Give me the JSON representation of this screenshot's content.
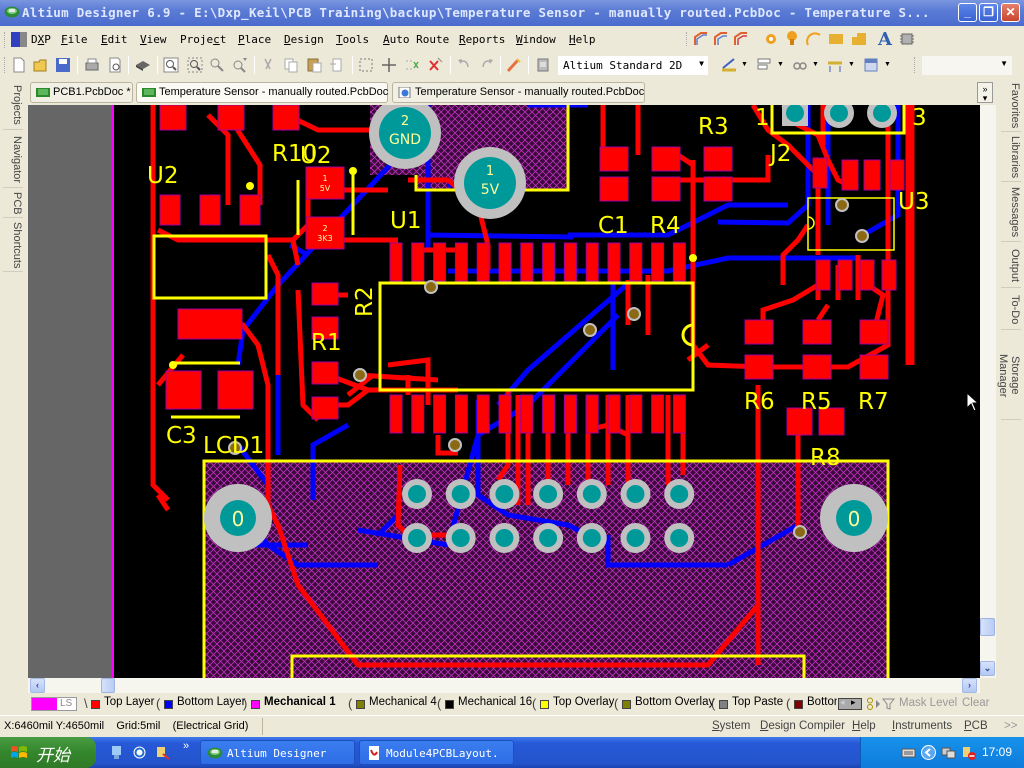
{
  "window": {
    "title": "Altium Designer 6.9 - E:\\Dxp_Keil\\PCB Training\\backup\\Temperature Sensor - manually routed.PcbDoc - Temperature S...",
    "minimize": "_",
    "restore": "❐",
    "close": "✕"
  },
  "menu": {
    "items": [
      {
        "label": "DXP",
        "underline": "X"
      },
      {
        "label": "File",
        "underline": "F"
      },
      {
        "label": "Edit",
        "underline": "E"
      },
      {
        "label": "View",
        "underline": "V"
      },
      {
        "label": "Project",
        "underline": "c"
      },
      {
        "label": "Place",
        "underline": "P"
      },
      {
        "label": "Design",
        "underline": "D"
      },
      {
        "label": "Tools",
        "underline": "T"
      },
      {
        "label": "Auto Route",
        "underline": "A"
      },
      {
        "label": "Reports",
        "underline": "R"
      },
      {
        "label": "Window",
        "underline": "W"
      },
      {
        "label": "Help",
        "underline": "H"
      }
    ]
  },
  "toolbar": {
    "view_mode": "Altium Standard 2D",
    "right_combo_value": "",
    "buttons": [
      "new-doc",
      "open",
      "save",
      "print",
      "print-preview",
      "3d-view",
      "fit-document",
      "zoom-area",
      "zoom-in",
      "zoom-out",
      "cut",
      "copy",
      "paste",
      "paste-special",
      "select-area",
      "move",
      "deselect",
      "clear-filter",
      "undo",
      "redo",
      "cross-probe",
      "component-library"
    ]
  },
  "doc_tabs": [
    {
      "label": "PCB1.PcbDoc *",
      "icon": "pcb-doc-icon",
      "active": false
    },
    {
      "label": "Temperature Sensor - manually routed.PcbDoc",
      "icon": "pcb-doc-icon",
      "active": true
    },
    {
      "label": "Temperature Sensor - manually routed.PcbDoc",
      "icon": "browser-doc-icon",
      "active": false
    }
  ],
  "tabs_more": "»",
  "left_panels": [
    "Projects",
    "Navigator",
    "PCB",
    "Shortcuts"
  ],
  "right_panels": [
    "Favorites",
    "Libraries",
    "Messages",
    "Output",
    "To-Do",
    "Storage Manager"
  ],
  "pcb": {
    "colors": {
      "top_layer": "#ff0000",
      "bottom_layer": "#0000ff",
      "mechanical1": "#ff00ff",
      "top_overlay": "#ffff00",
      "pad_hole": "#009999",
      "pad_ring": "#c0c0c0",
      "via": "#8b6914",
      "background": "#000000",
      "board_outside": "#666666"
    },
    "designators": [
      "U2",
      "R10",
      "U2_2",
      "U1",
      "R3",
      "J2",
      "U3",
      "C1",
      "R4",
      "R2",
      "R1",
      "C3",
      "LCD1",
      "R6",
      "R5",
      "R7",
      "R8"
    ],
    "labels": {
      "u2": "U2",
      "r10": "R10",
      "u2b": "U2",
      "u1": "U1",
      "r3": "R3",
      "j2": "J2",
      "j2_pin1": "1",
      "j2_pin3": "3",
      "u3": "U3",
      "c1": "C1",
      "r4": "R4",
      "r2": "R2",
      "r1": "R1",
      "c3": "C3",
      "lcd1": "LCD1",
      "r6": "R6",
      "r5": "R5",
      "r7": "R7",
      "r8": "R8"
    },
    "power_pads": [
      {
        "number": "2",
        "net": "GND"
      },
      {
        "number": "1",
        "net": "5V"
      }
    ],
    "mount_holes": [
      "0",
      "0"
    ],
    "small_pad_labels": {
      "u2_vr1": "1",
      "u2_vr1_net": "5V",
      "u2_vr2": "2",
      "u2_vr2_net": "3K3"
    }
  },
  "layers": {
    "ls_label": "LS",
    "tabs": [
      {
        "label": "Top Layer",
        "color": "#ff0000",
        "active": false
      },
      {
        "label": "Bottom Layer",
        "color": "#0000ff",
        "active": false
      },
      {
        "label": "Mechanical 1",
        "color": "#ff00ff",
        "active": true
      },
      {
        "label": "Mechanical 4",
        "color": "#808000",
        "active": false
      },
      {
        "label": "Mechanical 16",
        "color": "#000000",
        "active": false
      },
      {
        "label": "Top Overlay",
        "color": "#ffff00",
        "active": false
      },
      {
        "label": "Bottom Overlay",
        "color": "#808000",
        "active": false
      },
      {
        "label": "Top Paste",
        "color": "#808080",
        "active": false
      },
      {
        "label": "Bottom",
        "color": "#800000",
        "active": false
      }
    ],
    "mask_level": "Mask Level",
    "clear": "Clear"
  },
  "status": {
    "coords": "X:6460mil Y:4650mil",
    "grid": "Grid:5mil",
    "grid_type": "(Electrical Grid)",
    "panels": [
      {
        "label": "System",
        "underline": "S"
      },
      {
        "label": "Design Compiler",
        "underline": "D"
      },
      {
        "label": "Help",
        "underline": "H"
      },
      {
        "label": "Instruments",
        "underline": "I"
      },
      {
        "label": "PCB",
        "underline": "P"
      }
    ],
    "more": ">>"
  },
  "taskbar": {
    "start_label": "开始",
    "quick_launch_more": "»",
    "tasks": [
      {
        "label": "Altium Designer",
        "icon": "altium-icon"
      },
      {
        "label": "Module4PCBLayout.",
        "icon": "pdf-icon"
      }
    ],
    "clock": "17:09"
  }
}
